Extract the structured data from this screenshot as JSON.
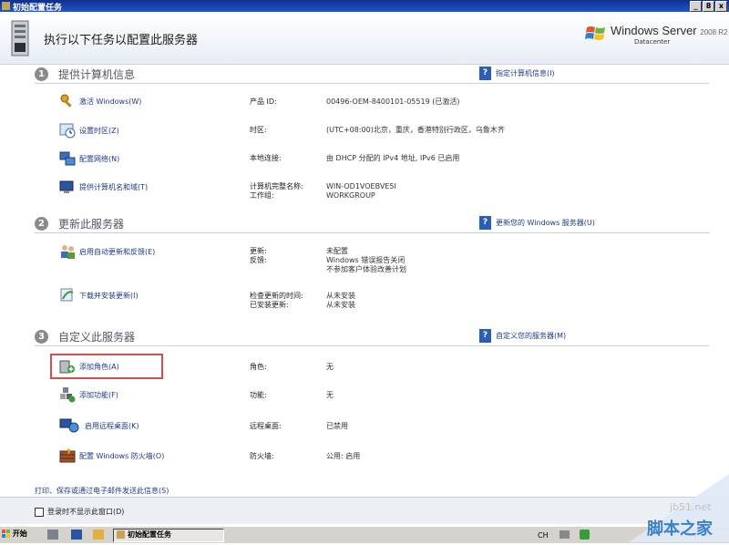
{
  "window": {
    "title": "初始配置任务",
    "header_title": "执行以下任务以配置此服务器",
    "brand_name": "Windows Server",
    "brand_version": "2008 R2",
    "brand_edition": "Datacenter",
    "buttons": [
      "_",
      "8",
      "x"
    ]
  },
  "sections": [
    {
      "number": "1",
      "title": "提供计算机信息",
      "link": "指定计算机信息(I)",
      "tasks": [
        {
          "label": "激活 Windows(W)",
          "icon": "key-icon",
          "prop": "产品 ID:",
          "value": "00496-OEM-8400101-05519 (已激活)"
        },
        {
          "label": "设置时区(Z)",
          "icon": "clock-icon",
          "prop": "时区:",
          "value": "(UTC+08:00)北京，重庆，香港特别行政区，乌鲁木齐"
        },
        {
          "label": "配置网络(N)",
          "icon": "network-icon",
          "prop": "本地连接:",
          "value": "由 DHCP 分配的 IPv4 地址, IPv6 已启用"
        },
        {
          "label": "提供计算机名和域(T)",
          "icon": "computer-icon",
          "prop": "计算机完整名称:\n工作组:",
          "value": "WIN-OD1VOEBVE5I\nWORKGROUP"
        }
      ]
    },
    {
      "number": "2",
      "title": "更新此服务器",
      "link": "更新您的 Windows 服务器(U)",
      "tasks": [
        {
          "label": "启用自动更新和反馈(E)",
          "icon": "users-icon",
          "prop": "更新:\n反馈:",
          "value": "未配置\nWindows 错误报告关闭\n不参加客户体验改善计划"
        },
        {
          "label": "下载并安装更新(I)",
          "icon": "update-icon",
          "prop": "检查更新的时间:\n已安装更新:",
          "value": "从未安装\n从未安装"
        }
      ]
    },
    {
      "number": "3",
      "title": "自定义此服务器",
      "link": "自定义您的服务器(M)",
      "tasks": [
        {
          "label": "添加角色(A)",
          "icon": "add-role-icon",
          "prop": "角色:",
          "value": "无"
        },
        {
          "label": "添加功能(F)",
          "icon": "add-feature-icon",
          "prop": "功能:",
          "value": "无"
        },
        {
          "label": "启用远程桌面(K)",
          "icon": "remote-desktop-icon",
          "prop": "远程桌面:",
          "value": "已禁用"
        },
        {
          "label": "配置 Windows 防火墙(O)",
          "icon": "firewall-icon",
          "prop": "防火墙:",
          "value": "公用: 启用"
        }
      ]
    }
  ],
  "footer_link": "打印、保存或通过电子邮件发送此信息(S)",
  "checkbox_label": "登录时不显示此窗口(D)",
  "taskbar": {
    "start_label": "开始",
    "task_label": "初始配置任务",
    "tray_text": "CH"
  },
  "watermark": {
    "line1": "jb51.net",
    "line2": "脚本之家"
  }
}
